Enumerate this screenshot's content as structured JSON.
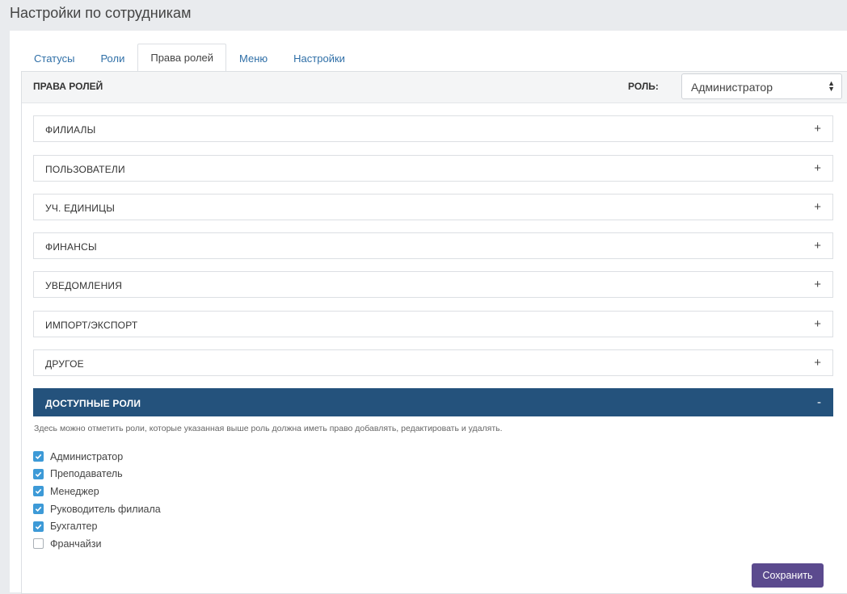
{
  "page": {
    "title": "Настройки по сотрудникам"
  },
  "tabs": [
    {
      "label": "Статусы",
      "active": false
    },
    {
      "label": "Роли",
      "active": false
    },
    {
      "label": "Права ролей",
      "active": true
    },
    {
      "label": "Меню",
      "active": false
    },
    {
      "label": "Настройки",
      "active": false
    }
  ],
  "panel": {
    "title": "ПРАВА РОЛЕЙ",
    "role_label": "РОЛЬ:",
    "role_value": "Администратор"
  },
  "sections": [
    {
      "label": "ФИЛИАЛЫ",
      "sign": "+"
    },
    {
      "label": "ПОЛЬЗОВАТЕЛИ",
      "sign": "+"
    },
    {
      "label": "УЧ. ЕДИНИЦЫ",
      "sign": "+"
    },
    {
      "label": "ФИНАНСЫ",
      "sign": "+"
    },
    {
      "label": "УВЕДОМЛЕНИЯ",
      "sign": "+"
    },
    {
      "label": "ИМПОРТ/ЭКСПОРТ",
      "sign": "+"
    },
    {
      "label": "ДРУГОЕ",
      "sign": "+"
    },
    {
      "label": "ДОСТУПНЫЕ РОЛИ",
      "sign": "-"
    }
  ],
  "available_roles": {
    "hint": "Здесь можно отметить роли, которые указанная выше роль должна иметь право добавлять, редактировать и удалять.",
    "items": [
      {
        "label": "Администратор",
        "checked": true
      },
      {
        "label": "Преподаватель",
        "checked": true
      },
      {
        "label": "Менеджер",
        "checked": true
      },
      {
        "label": "Руководитель филиала",
        "checked": true
      },
      {
        "label": "Бухгалтер",
        "checked": true
      },
      {
        "label": "Франчайзи",
        "checked": false
      }
    ]
  },
  "actions": {
    "save_label": "Сохранить"
  },
  "colors": {
    "accent": "#24527c",
    "checkbox": "#3d9ad7",
    "button": "#5b4a8e",
    "link": "#2f6fa7"
  }
}
